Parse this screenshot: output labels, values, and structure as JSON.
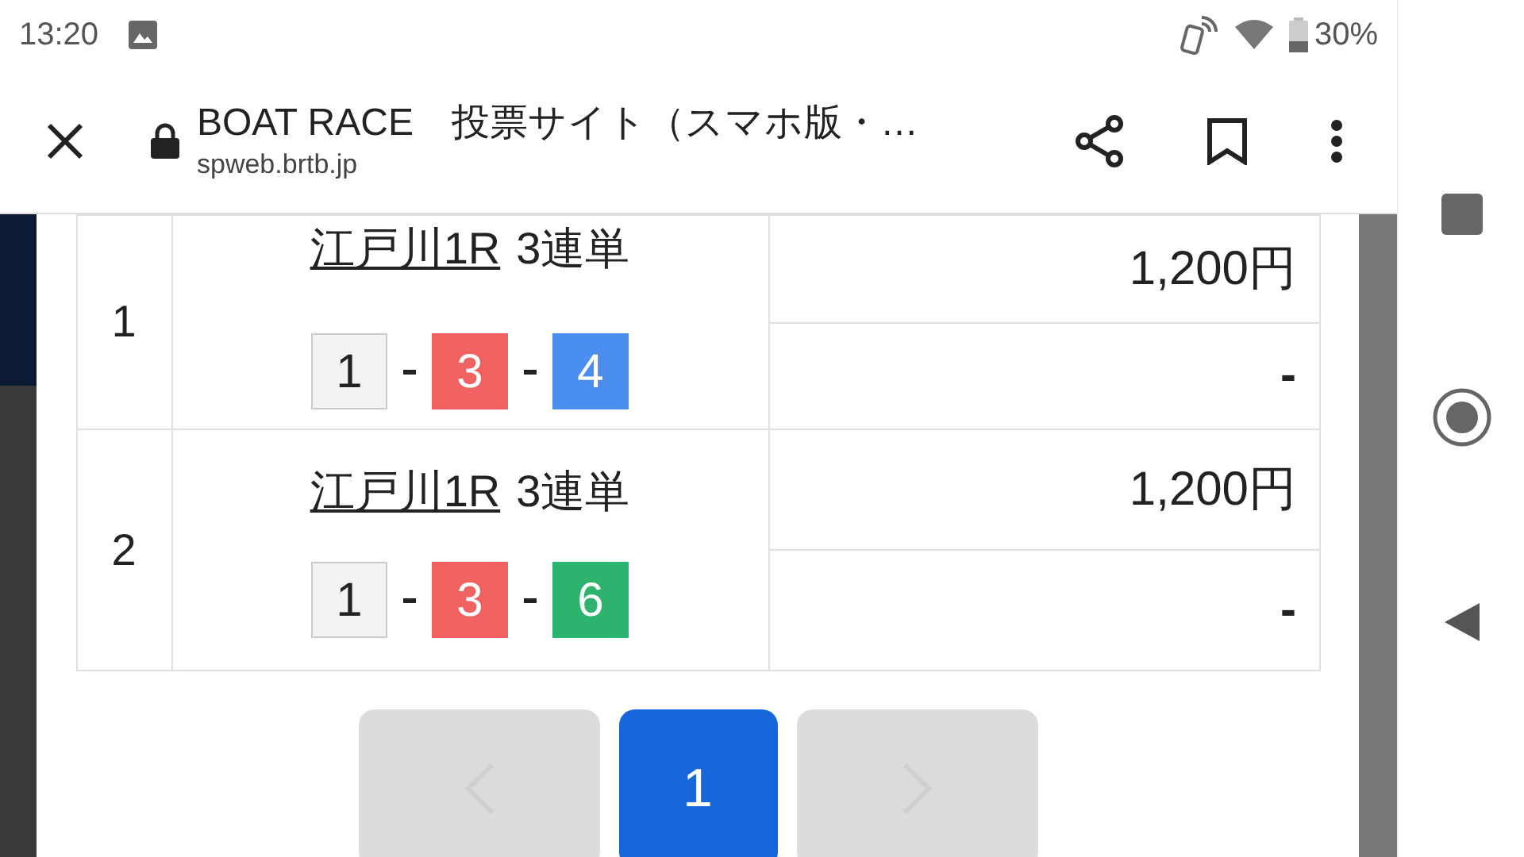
{
  "status_bar": {
    "time": "13:20",
    "battery": "30%"
  },
  "browser": {
    "title": "BOAT RACE　投票サイト（スマホ版・…",
    "url": "spweb.brtb.jp"
  },
  "bets": [
    {
      "index": "1",
      "race": "江戸川1R",
      "bet_type": "3連単",
      "combination": [
        {
          "number": "1",
          "color": "#f2f2f2"
        },
        {
          "number": "3",
          "color": "#f06262"
        },
        {
          "number": "4",
          "color": "#4a8ef0"
        }
      ],
      "amount": "1,200円",
      "result": "-"
    },
    {
      "index": "2",
      "race": "江戸川1R",
      "bet_type": "3連単",
      "combination": [
        {
          "number": "1",
          "color": "#f2f2f2"
        },
        {
          "number": "3",
          "color": "#f06262"
        },
        {
          "number": "6",
          "color": "#2eb36e"
        }
      ],
      "amount": "1,200円",
      "result": "-"
    }
  ],
  "pagination": {
    "prev": {
      "disabled": true
    },
    "pages": [
      {
        "label": "1",
        "selected": true
      }
    ],
    "next": {
      "disabled": true
    }
  }
}
